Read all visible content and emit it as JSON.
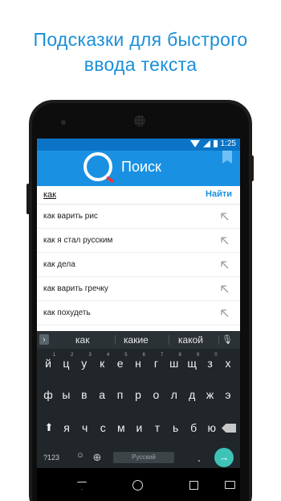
{
  "promo": {
    "line1": "Подсказки для быстрого",
    "line2": "ввода текста"
  },
  "status": {
    "time": "1:25"
  },
  "app": {
    "title": "Поиск"
  },
  "search": {
    "value": "как",
    "button_label": "Найти"
  },
  "suggestions": [
    {
      "text": "как варить рис"
    },
    {
      "text": "как я стал русским"
    },
    {
      "text": "как дела"
    },
    {
      "text": "как варить гречку"
    },
    {
      "text": "как похудеть"
    }
  ],
  "keyboard": {
    "suggestions": [
      "как",
      "какие",
      "какой"
    ],
    "row1": [
      {
        "k": "й",
        "n": "1"
      },
      {
        "k": "ц",
        "n": "2"
      },
      {
        "k": "у",
        "n": "3"
      },
      {
        "k": "к",
        "n": "4"
      },
      {
        "k": "е",
        "n": "5"
      },
      {
        "k": "н",
        "n": "6"
      },
      {
        "k": "г",
        "n": "7"
      },
      {
        "k": "ш",
        "n": "8"
      },
      {
        "k": "щ",
        "n": "9"
      },
      {
        "k": "з",
        "n": "0"
      },
      {
        "k": "х",
        "n": ""
      }
    ],
    "row2": [
      "ф",
      "ы",
      "в",
      "а",
      "п",
      "р",
      "о",
      "л",
      "д",
      "ж",
      "э"
    ],
    "row3": [
      "я",
      "ч",
      "с",
      "м",
      "и",
      "т",
      "ь",
      "б",
      "ю"
    ],
    "symbols_label": "?123",
    "space_label": "Русский",
    "period": "."
  },
  "colors": {
    "accent": "#1a90e2",
    "statusbar": "#0b74c7",
    "enter": "#3ec3b7",
    "keyboard_bg": "#20262a"
  },
  "icons": [
    "wifi-icon",
    "signal-icon",
    "battery-icon",
    "bookmark-icon",
    "arrow-up-left-icon",
    "mic-icon",
    "shift-icon",
    "backspace-icon",
    "globe-icon",
    "emoji-icon",
    "enter-icon",
    "back-icon",
    "home-icon",
    "recents-icon",
    "keyboard-icon"
  ]
}
